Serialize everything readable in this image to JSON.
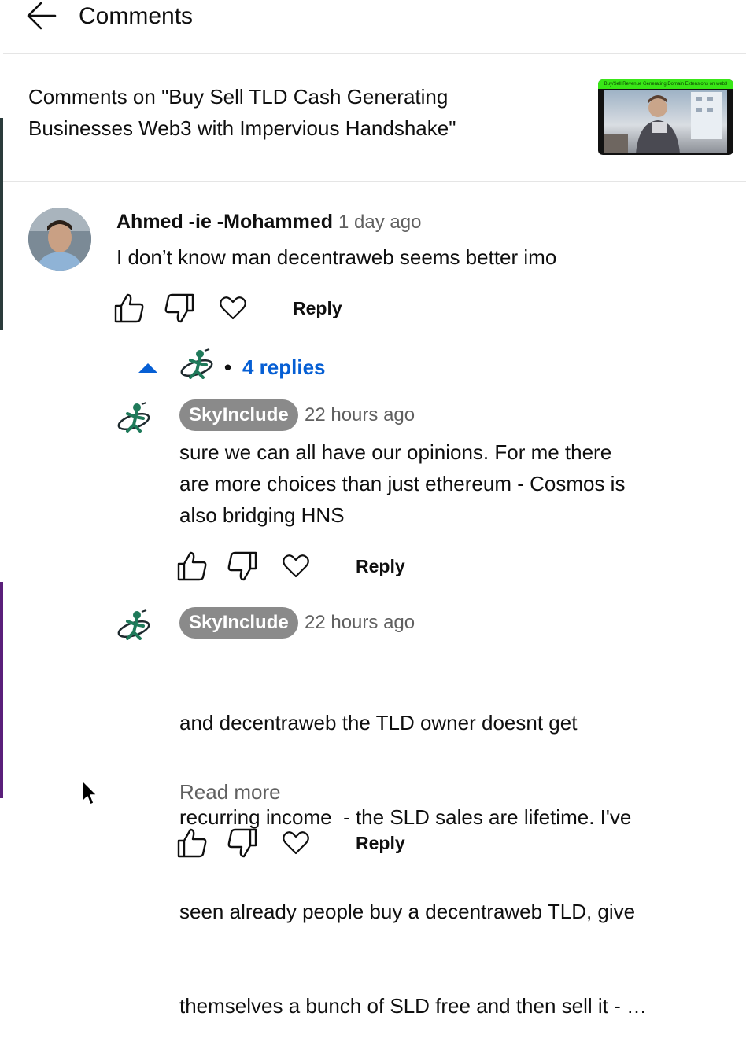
{
  "header": {
    "title": "Comments",
    "back_icon": "arrow-left-icon"
  },
  "video": {
    "title_line1": "Comments on \"Buy Sell TLD Cash Generating",
    "title_line2": "Businesses Web3 with Impervious Handshake\"",
    "thumbnail_banner": "Buy/Sell Revenue Generating Domain Extensions on web3"
  },
  "comment": {
    "author": "Ahmed -ie -Mohammed",
    "time": "1 day ago",
    "text": "I don’t know man decentraweb seems better imo",
    "reply_label": "Reply",
    "replies_count_label": "4 replies",
    "replies_separator": "•"
  },
  "replies": [
    {
      "author": "SkyInclude",
      "time": "22 hours ago",
      "lines": [
        "sure we can all have our opinions. For me there",
        "are more choices than just ethereum - Cosmos is",
        "also bridging HNS"
      ],
      "reply_label": "Reply"
    },
    {
      "author": "SkyInclude",
      "time": "22 hours ago",
      "lines": [
        "and decentraweb the TLD owner doesnt get",
        "recurring income  - the SLD sales are lifetime. I've",
        "seen already people buy a decentraweb TLD, give",
        "themselves a bunch of SLD free and then sell it - …"
      ],
      "read_more": "Read more",
      "reply_label": "Reply"
    }
  ],
  "icons": {
    "like": "thumb-up-icon",
    "dislike": "thumb-down-icon",
    "heart": "heart-icon",
    "collapse": "caret-up-icon"
  },
  "colors": {
    "link_blue": "#065fd4",
    "pill_gray": "#8a8a8a",
    "muted_text": "#606060",
    "divider": "#e5e5e5"
  }
}
